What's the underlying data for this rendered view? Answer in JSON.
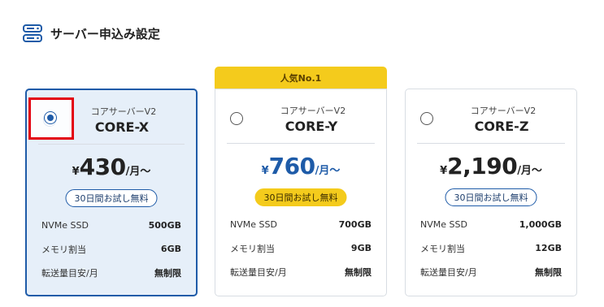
{
  "section": {
    "title": "サーバー申込み設定",
    "icon": "server-icon",
    "accent": "#1e5ba8"
  },
  "popular_badge": "人気No.1",
  "plans": [
    {
      "series": "コアサーバーV2",
      "name": "CORE-X",
      "selected": true,
      "price": {
        "yen": "¥",
        "amount": "430",
        "unit": "/月〜"
      },
      "trial": "30日間お試し無料",
      "specs": [
        {
          "label": "NVMe SSD",
          "value": "500GB"
        },
        {
          "label": "メモリ割当",
          "value": "6GB"
        },
        {
          "label": "転送量目安/月",
          "value": "無制限"
        }
      ]
    },
    {
      "series": "コアサーバーV2",
      "name": "CORE-Y",
      "selected": false,
      "price": {
        "yen": "¥",
        "amount": "760",
        "unit": "/月〜"
      },
      "trial": "30日間お試し無料",
      "specs": [
        {
          "label": "NVMe SSD",
          "value": "700GB"
        },
        {
          "label": "メモリ割当",
          "value": "9GB"
        },
        {
          "label": "転送量目安/月",
          "value": "無制限"
        }
      ]
    },
    {
      "series": "コアサーバーV2",
      "name": "CORE-Z",
      "selected": false,
      "price": {
        "yen": "¥",
        "amount": "2,190",
        "unit": "/月〜"
      },
      "trial": "30日間お試し無料",
      "specs": [
        {
          "label": "NVMe SSD",
          "value": "1,000GB"
        },
        {
          "label": "メモリ割当",
          "value": "12GB"
        },
        {
          "label": "転送量目安/月",
          "value": "無制限"
        }
      ]
    }
  ],
  "colors": {
    "brand_blue": "#1e5ba8",
    "selected_bg": "#e6eff9",
    "popular_yellow": "#f4cb1c",
    "highlight_red": "#e3000f"
  }
}
